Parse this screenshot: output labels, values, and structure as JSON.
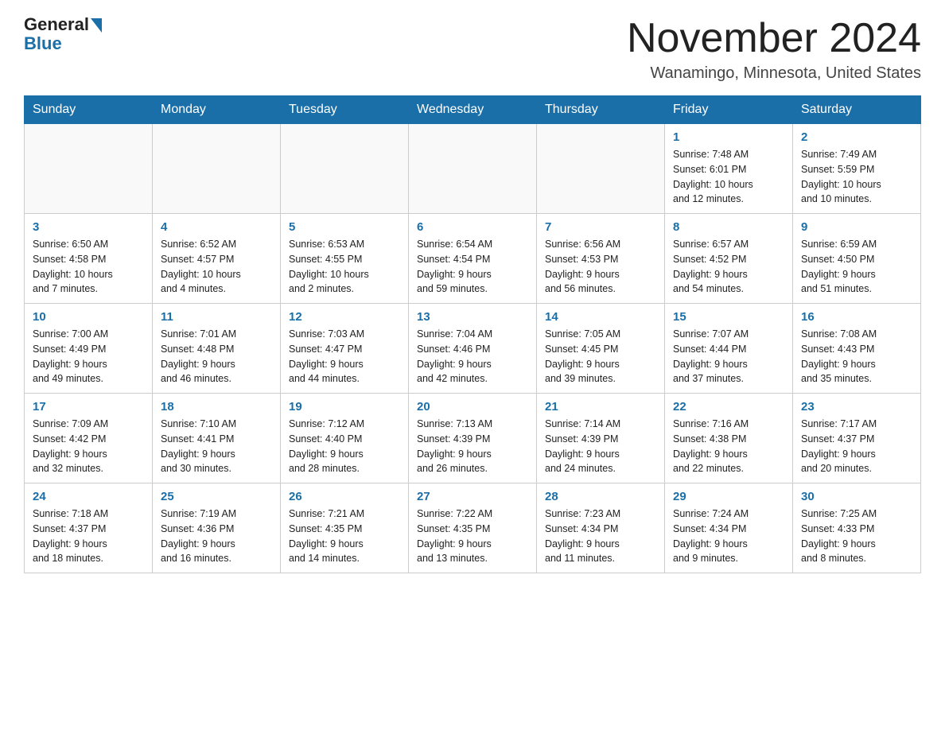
{
  "header": {
    "logo_general": "General",
    "logo_blue": "Blue",
    "month_title": "November 2024",
    "location": "Wanamingo, Minnesota, United States"
  },
  "weekdays": [
    "Sunday",
    "Monday",
    "Tuesday",
    "Wednesday",
    "Thursday",
    "Friday",
    "Saturday"
  ],
  "weeks": [
    [
      {
        "day": "",
        "detail": ""
      },
      {
        "day": "",
        "detail": ""
      },
      {
        "day": "",
        "detail": ""
      },
      {
        "day": "",
        "detail": ""
      },
      {
        "day": "",
        "detail": ""
      },
      {
        "day": "1",
        "detail": "Sunrise: 7:48 AM\nSunset: 6:01 PM\nDaylight: 10 hours\nand 12 minutes."
      },
      {
        "day": "2",
        "detail": "Sunrise: 7:49 AM\nSunset: 5:59 PM\nDaylight: 10 hours\nand 10 minutes."
      }
    ],
    [
      {
        "day": "3",
        "detail": "Sunrise: 6:50 AM\nSunset: 4:58 PM\nDaylight: 10 hours\nand 7 minutes."
      },
      {
        "day": "4",
        "detail": "Sunrise: 6:52 AM\nSunset: 4:57 PM\nDaylight: 10 hours\nand 4 minutes."
      },
      {
        "day": "5",
        "detail": "Sunrise: 6:53 AM\nSunset: 4:55 PM\nDaylight: 10 hours\nand 2 minutes."
      },
      {
        "day": "6",
        "detail": "Sunrise: 6:54 AM\nSunset: 4:54 PM\nDaylight: 9 hours\nand 59 minutes."
      },
      {
        "day": "7",
        "detail": "Sunrise: 6:56 AM\nSunset: 4:53 PM\nDaylight: 9 hours\nand 56 minutes."
      },
      {
        "day": "8",
        "detail": "Sunrise: 6:57 AM\nSunset: 4:52 PM\nDaylight: 9 hours\nand 54 minutes."
      },
      {
        "day": "9",
        "detail": "Sunrise: 6:59 AM\nSunset: 4:50 PM\nDaylight: 9 hours\nand 51 minutes."
      }
    ],
    [
      {
        "day": "10",
        "detail": "Sunrise: 7:00 AM\nSunset: 4:49 PM\nDaylight: 9 hours\nand 49 minutes."
      },
      {
        "day": "11",
        "detail": "Sunrise: 7:01 AM\nSunset: 4:48 PM\nDaylight: 9 hours\nand 46 minutes."
      },
      {
        "day": "12",
        "detail": "Sunrise: 7:03 AM\nSunset: 4:47 PM\nDaylight: 9 hours\nand 44 minutes."
      },
      {
        "day": "13",
        "detail": "Sunrise: 7:04 AM\nSunset: 4:46 PM\nDaylight: 9 hours\nand 42 minutes."
      },
      {
        "day": "14",
        "detail": "Sunrise: 7:05 AM\nSunset: 4:45 PM\nDaylight: 9 hours\nand 39 minutes."
      },
      {
        "day": "15",
        "detail": "Sunrise: 7:07 AM\nSunset: 4:44 PM\nDaylight: 9 hours\nand 37 minutes."
      },
      {
        "day": "16",
        "detail": "Sunrise: 7:08 AM\nSunset: 4:43 PM\nDaylight: 9 hours\nand 35 minutes."
      }
    ],
    [
      {
        "day": "17",
        "detail": "Sunrise: 7:09 AM\nSunset: 4:42 PM\nDaylight: 9 hours\nand 32 minutes."
      },
      {
        "day": "18",
        "detail": "Sunrise: 7:10 AM\nSunset: 4:41 PM\nDaylight: 9 hours\nand 30 minutes."
      },
      {
        "day": "19",
        "detail": "Sunrise: 7:12 AM\nSunset: 4:40 PM\nDaylight: 9 hours\nand 28 minutes."
      },
      {
        "day": "20",
        "detail": "Sunrise: 7:13 AM\nSunset: 4:39 PM\nDaylight: 9 hours\nand 26 minutes."
      },
      {
        "day": "21",
        "detail": "Sunrise: 7:14 AM\nSunset: 4:39 PM\nDaylight: 9 hours\nand 24 minutes."
      },
      {
        "day": "22",
        "detail": "Sunrise: 7:16 AM\nSunset: 4:38 PM\nDaylight: 9 hours\nand 22 minutes."
      },
      {
        "day": "23",
        "detail": "Sunrise: 7:17 AM\nSunset: 4:37 PM\nDaylight: 9 hours\nand 20 minutes."
      }
    ],
    [
      {
        "day": "24",
        "detail": "Sunrise: 7:18 AM\nSunset: 4:37 PM\nDaylight: 9 hours\nand 18 minutes."
      },
      {
        "day": "25",
        "detail": "Sunrise: 7:19 AM\nSunset: 4:36 PM\nDaylight: 9 hours\nand 16 minutes."
      },
      {
        "day": "26",
        "detail": "Sunrise: 7:21 AM\nSunset: 4:35 PM\nDaylight: 9 hours\nand 14 minutes."
      },
      {
        "day": "27",
        "detail": "Sunrise: 7:22 AM\nSunset: 4:35 PM\nDaylight: 9 hours\nand 13 minutes."
      },
      {
        "day": "28",
        "detail": "Sunrise: 7:23 AM\nSunset: 4:34 PM\nDaylight: 9 hours\nand 11 minutes."
      },
      {
        "day": "29",
        "detail": "Sunrise: 7:24 AM\nSunset: 4:34 PM\nDaylight: 9 hours\nand 9 minutes."
      },
      {
        "day": "30",
        "detail": "Sunrise: 7:25 AM\nSunset: 4:33 PM\nDaylight: 9 hours\nand 8 minutes."
      }
    ]
  ]
}
